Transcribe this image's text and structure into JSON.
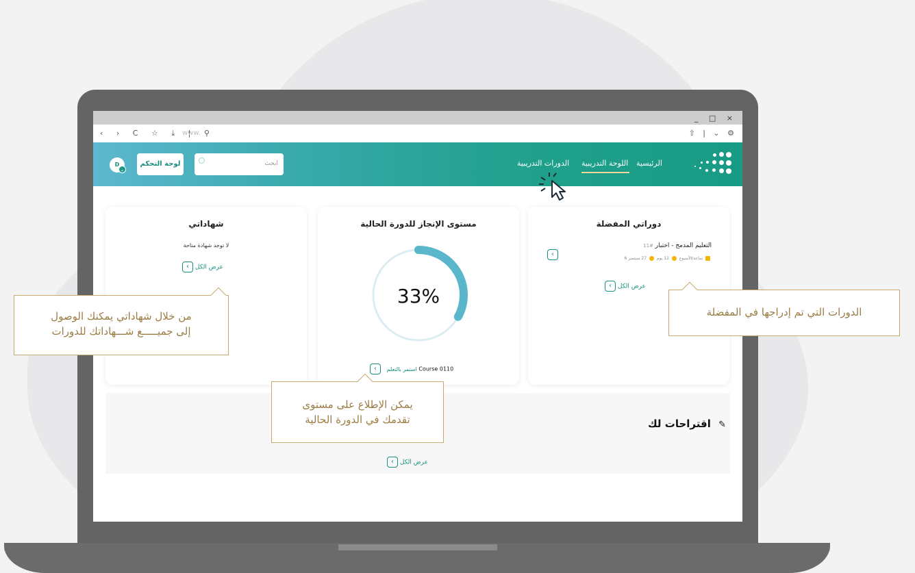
{
  "browser": {
    "window_controls": "_ □ ×",
    "nav_icons": "‹ › C ☆ ⤓ | ⚲",
    "address_placeholder": "www.",
    "right_icons": "⇧ | ⌄ ⚙"
  },
  "header": {
    "avatar_initial": "D",
    "dashboard_button": "لوحة التحكم",
    "search_placeholder": "ابحث",
    "nav": {
      "home": "الرئيسية",
      "training_board": "اللوحة التدريبية",
      "training_courses": "الدورات التدريبية"
    }
  },
  "cards": {
    "certificates": {
      "title": "شهاداتي",
      "empty_text": "لا توجد شهادة متاحة",
      "view_all": "عرض الكل"
    },
    "progress": {
      "title": "مستوى الإنجاز للدورة الحالية",
      "percent_label": "33%",
      "percent_value": 33,
      "course_name": "Course 0110",
      "continue_label": "استمر بالتعلم"
    },
    "favorites": {
      "title": "دوراتي المفضلة",
      "course_number": "#11",
      "course_title": "التعليم المدمج - اختبار",
      "meta_date": "27 سبتمبر",
      "meta_duration": "12 يوم",
      "meta_hours": "6 ساعة/الأسبوع",
      "view_all": "عرض الكل"
    }
  },
  "suggestions": {
    "title": "اقتراحات لك",
    "view_all": "عرض الكل"
  },
  "callouts": {
    "certificates_line1": "من خلال شهاداتي يمكنك الوصول",
    "certificates_line2": "إلى جميـــــع شـــهاداتك للدورات",
    "favorites": "الدورات التي تم إدراجها في المفضلة",
    "progress_line1": "يمكن الإطلاع على مستوى",
    "progress_line2": "تقدمك في الدورة الحالية"
  },
  "colors": {
    "accent": "#16907c",
    "header_start": "#5db8cf",
    "header_end": "#189a84",
    "progress_ring": "#5ab7cb",
    "callout_border": "#c8aa6e"
  }
}
